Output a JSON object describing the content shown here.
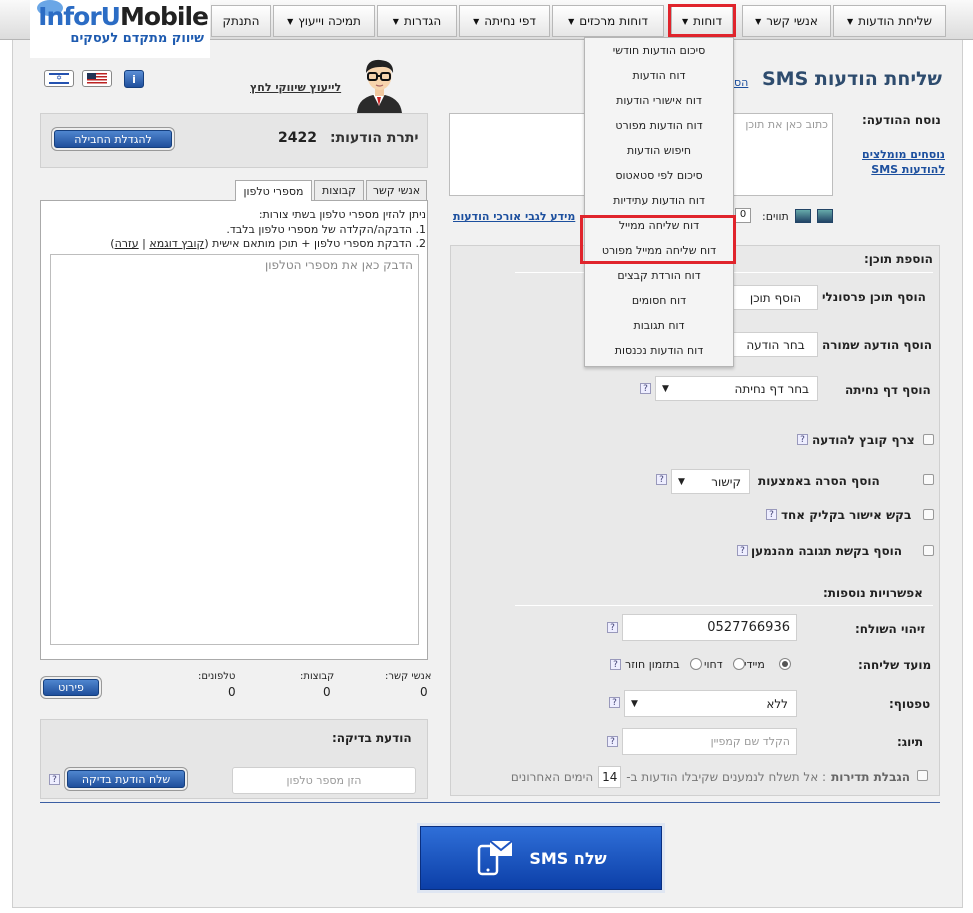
{
  "nav": [
    "שליחת הודעות",
    "אנשי קשר",
    "דוחות",
    "דוחות מרכזים",
    "דפי נחיתה",
    "הגדרות",
    "תמיכה וייעוץ",
    "התנתק"
  ],
  "logo": {
    "brand_part1": "InforU",
    "brand_part2": "Mobile",
    "tagline": "שיווק מתקדם לעסקים"
  },
  "reports_menu": [
    "סיכום הודעות חודשי",
    "דוח הודעות",
    "דוח אישורי הודעות",
    "דוח הודעות מפורט",
    "חיפוש הודעות",
    "סיכום לפי סטאטוס",
    "דוח הודעות עתידיות",
    "דוח שליחה ממייל",
    "דוח שליחה ממייל מפורט",
    "דוח הורדת קבצים",
    "דוח חסומים",
    "דוח תגובות",
    "דוח הודעות נכנסות"
  ],
  "page_title": "שליחת הודעות SMS",
  "title_link": "הס",
  "consultant_link": "לייעוץ שיווקי לחץ",
  "balance": {
    "label": "יתרת הודעות:",
    "value": "2422",
    "upgrade_button": "להגדלת החבילה"
  },
  "tabs": [
    "אנשי קשר",
    "קבוצות",
    "מספרי טלפון"
  ],
  "phones": {
    "instr1": "ניתן להזין מספרי טלפון בשתי צורות:",
    "instr2": "1. הדבקה/הקלדה של מספרי טלפון בלבד.",
    "instr3": "2. הדבקת מספרי טלפון + תוכן מותאם אישית (",
    "example_link": "קובץ דוגמא",
    "sep": "|",
    "help_link": "עזרה",
    "close_paren": ")",
    "placeholder": "הדבק כאן את מספרי הטלפון"
  },
  "counts": {
    "contacts_label": "אנשי קשר:",
    "contacts_value": "0",
    "groups_label": "קבוצות:",
    "groups_value": "0",
    "phones_label": "טלפונים:",
    "phones_value": "0",
    "details_button": "פירוט"
  },
  "test": {
    "title": "הודעת בדיקה:",
    "placeholder": "הזן מספר טלפון",
    "send_button": "שלח הודעת בדיקה"
  },
  "message": {
    "label": "נוסח ההודעה:",
    "placeholder": "כתוב כאן את תוכן",
    "recommended_link": "נוסחים מומלצים להודעות SMS",
    "chars_label": "תווים:",
    "chars_value": "0",
    "long_msg_link": "מידע לגבי אורכי הודעות"
  },
  "content": {
    "title": "הוספת תוכן:",
    "personal_label": "הוסף תוכן פרסונלי",
    "personal_button": "הוסף תוכן",
    "saved_label": "הוסף הודעה שמורה",
    "saved_button": "בחר הודעה",
    "landing_label": "הוסף דף נחיתה",
    "landing_select": "בחר דף נחיתה",
    "attach_label": "צרף קובץ להודעה",
    "image_label": "הוסף הסרה באמצעות",
    "image_select": "קישור",
    "approve_label": "בקש אישור בקליק אחד",
    "reply_label": "הוסף בקשת תגובה מהנמען"
  },
  "extra": {
    "title": "אפשרויות נוספות:",
    "sender_label": "זיהוי השולח:",
    "sender_value": "0527766936",
    "time_label": "מועד שליחה:",
    "opt_now": "מיידי",
    "opt_later": "דחוי",
    "opt_recurring": "בתזמון חוזר",
    "throttle_label": "טפטוף:",
    "throttle_value": "ללא",
    "tag_label": "תיוג:",
    "tag_placeholder": "הקלד שם קמפיין",
    "freq_label": "הגבלת תדירות",
    "freq_text1": ": אל תשלח לנמענים שקיבלו הודעות ב-",
    "freq_days": "14",
    "freq_text2": "הימים האחרונים"
  },
  "send_button": "שלח SMS"
}
